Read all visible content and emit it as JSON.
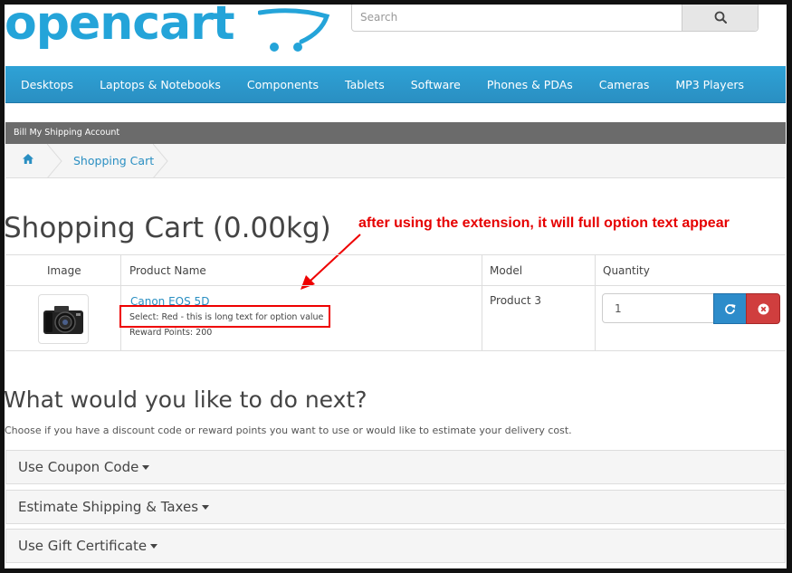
{
  "header": {
    "logo_text": "opencart",
    "search_placeholder": "Search"
  },
  "menu": {
    "items": [
      "Desktops",
      "Laptops & Notebooks",
      "Components",
      "Tablets",
      "Software",
      "Phones & PDAs",
      "Cameras",
      "MP3 Players"
    ]
  },
  "top_bar": {
    "label": "Bill My Shipping Account"
  },
  "breadcrumb": {
    "current": "Shopping Cart"
  },
  "page": {
    "title": "Shopping Cart  (0.00kg)"
  },
  "annotation": {
    "text": "after using the extension, it will full option text appear",
    "color": "#e60000"
  },
  "cart_table": {
    "headers": {
      "image": "Image",
      "name": "Product Name",
      "model": "Model",
      "quantity": "Quantity"
    },
    "rows": [
      {
        "name": "Canon EOS 5D",
        "option": "Select: Red - this is long text for option value",
        "reward": "Reward Points: 200",
        "model": "Product 3",
        "quantity": "1"
      }
    ]
  },
  "next": {
    "title": "What would you like to do next?",
    "description": "Choose if you have a discount code or reward points you want to use or would like to estimate your delivery cost.",
    "panels": [
      "Use Coupon Code",
      "Estimate Shipping & Taxes",
      "Use Gift Certificate"
    ]
  },
  "colors": {
    "brand": "#24a4d9",
    "menu": "#2a8fc2",
    "update": "#2d8cca",
    "remove": "#d03e3e"
  }
}
